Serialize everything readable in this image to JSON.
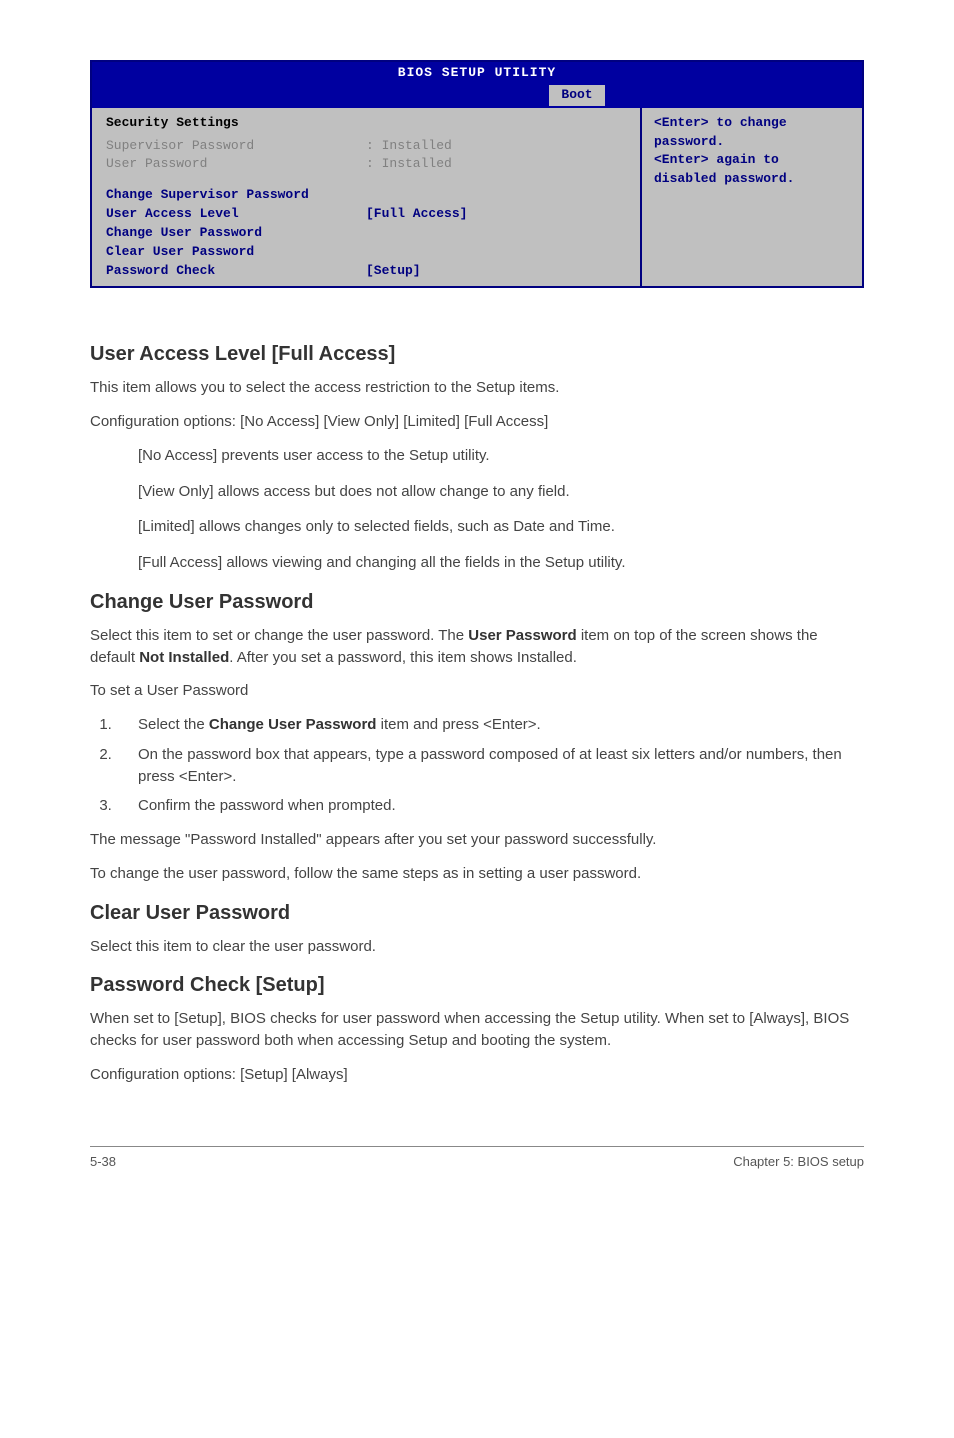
{
  "bios": {
    "title": "BIOS SETUP UTILITY",
    "tab": "Boot",
    "heading": "Security Settings",
    "supervisor_label": "Supervisor Password",
    "supervisor_value": ": Installed",
    "user_label": "User Password",
    "user_value": ": Installed",
    "change_supervisor": "Change Supervisor Password",
    "user_access_label": "User Access Level",
    "user_access_value": "[Full Access]",
    "change_user": "Change User Password",
    "clear_user": "Clear User Password",
    "password_check_label": "Password Check",
    "password_check_value": "[Setup]",
    "help_line1": "<Enter> to change",
    "help_line2": "password.",
    "help_line3": "<Enter> again to",
    "help_line4": "disabled password."
  },
  "sec_ual": {
    "heading": "User Access Level [Full Access]",
    "p1": "This item allows you to select the access restriction to the Setup items.",
    "p2": "Configuration options: [No Access] [View Only] [Limited] [Full Access]",
    "opt1": "[No Access] prevents user access to the Setup utility.",
    "opt2": "[View Only] allows access but does not allow change to any field.",
    "opt3": "[Limited] allows changes only to selected fields, such as Date and Time.",
    "opt4": "[Full Access] allows viewing and changing all the fields in the Setup utility."
  },
  "sec_cup": {
    "heading": "Change User Password",
    "p1a": "Select this item to set or change the user password. The ",
    "p1b": "User Password",
    "p1c": " item on top of the screen shows the default ",
    "p1d": "Not Installed",
    "p1e": ". After you set a password, this item shows Installed.",
    "p2": "To set a User Password",
    "li1a": "Select the ",
    "li1b": "Change User Password",
    "li1c": " item and press <Enter>.",
    "li2": "On the password box that appears, type a password composed of at least six letters and/or numbers, then press <Enter>.",
    "li3": "Confirm the password when prompted.",
    "p3": "The message \"Password Installed\" appears after you set your password successfully.",
    "p4": "To change the user password, follow the same steps as in setting a user password."
  },
  "sec_clup": {
    "heading": "Clear User Password",
    "p1": "Select this item to clear the user password."
  },
  "sec_pc": {
    "heading": "Password Check [Setup]",
    "p1": "When set to [Setup], BIOS checks for user password when accessing the Setup utility. When set to [Always], BIOS checks for user password both when accessing Setup and booting the system.",
    "p2": "Configuration options: [Setup] [Always]"
  },
  "footer": {
    "left": "5-38",
    "right": "Chapter 5: BIOS setup"
  }
}
